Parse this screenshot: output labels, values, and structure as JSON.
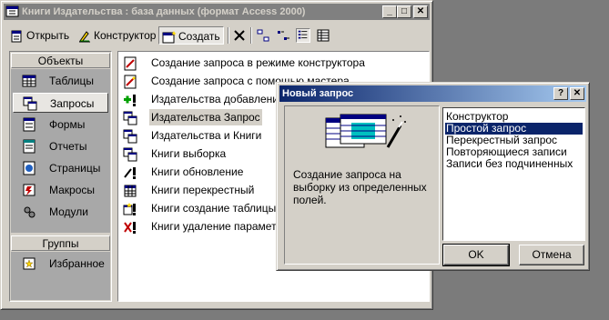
{
  "db_window": {
    "title": "Книги Издательства : база данных (формат Access 2000)",
    "controls": {
      "minimize": "_",
      "maximize": "□",
      "close": "✕"
    }
  },
  "toolbar": {
    "open_label": "Открыть",
    "design_label": "Конструктор",
    "create_label": "Создать"
  },
  "objects_panel": {
    "header": "Объекты",
    "items": [
      {
        "label": "Таблицы",
        "icon": "table-icon"
      },
      {
        "label": "Запросы",
        "icon": "query-icon",
        "selected": true
      },
      {
        "label": "Формы",
        "icon": "form-icon"
      },
      {
        "label": "Отчеты",
        "icon": "report-icon"
      },
      {
        "label": "Страницы",
        "icon": "page-icon"
      },
      {
        "label": "Макросы",
        "icon": "macro-icon"
      },
      {
        "label": "Модули",
        "icon": "module-icon"
      }
    ],
    "groups_header": "Группы",
    "groups": [
      {
        "label": "Избранное",
        "icon": "favorites-icon"
      }
    ]
  },
  "queries_list": [
    {
      "label": "Создание запроса в режиме конструктора",
      "icon": "design-wizard-icon"
    },
    {
      "label": "Создание запроса с помощью мастера",
      "icon": "wizard-icon"
    },
    {
      "label": "Издательства добавление",
      "icon": "append-query-icon"
    },
    {
      "label": "Издательства Запрос",
      "icon": "select-query-icon",
      "selected": true
    },
    {
      "label": "Издательства и Книги",
      "icon": "select-query-icon"
    },
    {
      "label": "Книги выборка",
      "icon": "select-query-icon"
    },
    {
      "label": "Книги обновление",
      "icon": "update-query-icon"
    },
    {
      "label": "Книги перекрестный",
      "icon": "crosstab-query-icon"
    },
    {
      "label": "Книги создание таблицы",
      "icon": "make-table-query-icon"
    },
    {
      "label": "Книги удаление параметри",
      "icon": "delete-query-icon"
    }
  ],
  "dialog": {
    "title": "Новый запрос",
    "help_button": "?",
    "close_button": "✕",
    "description": "Создание запроса на выборку из определенных полей.",
    "options": [
      {
        "label": "Конструктор"
      },
      {
        "label": "Простой запрос",
        "selected": true
      },
      {
        "label": "Перекрестный запрос"
      },
      {
        "label": "Повторяющиеся записи"
      },
      {
        "label": "Записи без подчиненных"
      }
    ],
    "ok_label": "OK",
    "cancel_label": "Отмена"
  }
}
